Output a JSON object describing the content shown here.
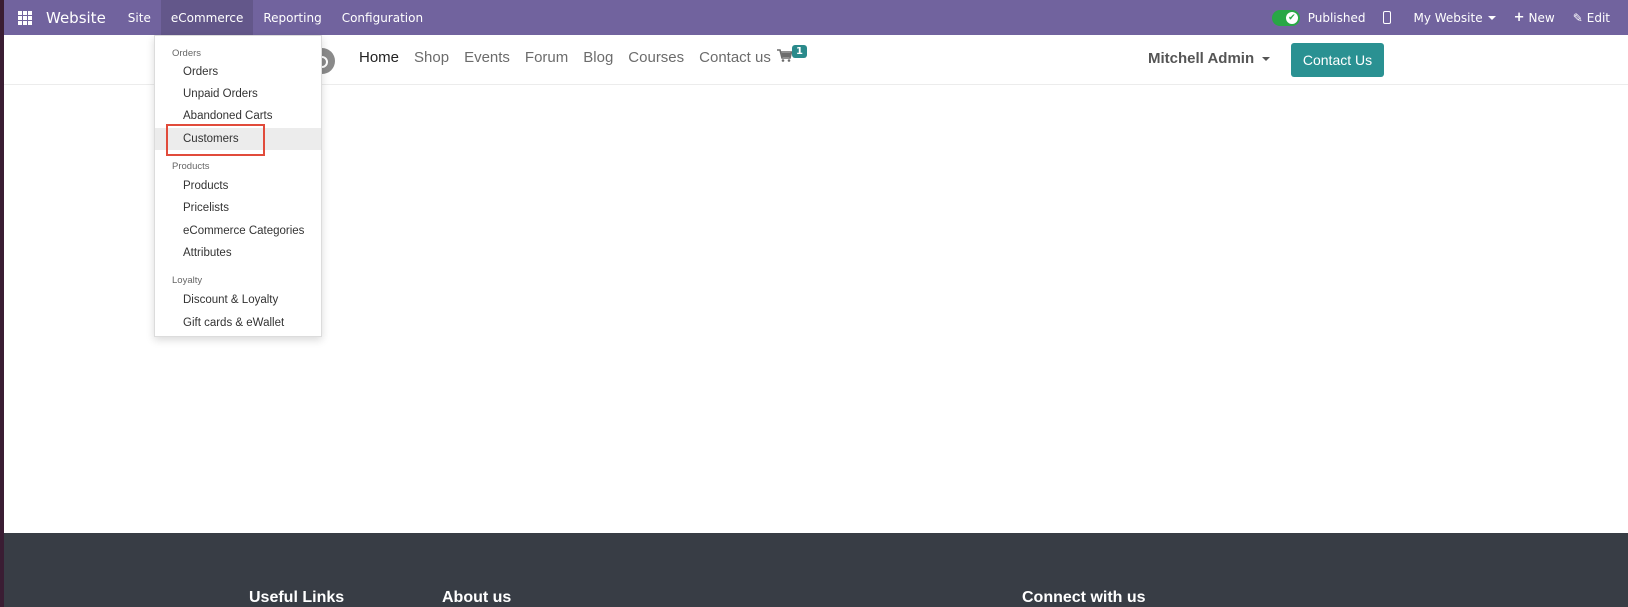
{
  "topbar": {
    "brand": "Website",
    "menu": [
      "Site",
      "eCommerce",
      "Reporting",
      "Configuration"
    ],
    "published_label": "Published",
    "website_label": "My Website",
    "new_label": "New",
    "edit_label": "Edit"
  },
  "site": {
    "nav": [
      "Home",
      "Shop",
      "Events",
      "Forum",
      "Blog",
      "Courses",
      "Contact us"
    ],
    "cart_count": "1",
    "user": "Mitchell Admin",
    "contact_button": "Contact Us"
  },
  "dropdown": {
    "sections": [
      {
        "header": "Orders",
        "items": [
          "Orders",
          "Unpaid Orders",
          "Abandoned Carts",
          "Customers"
        ]
      },
      {
        "header": "Products",
        "items": [
          "Products",
          "Pricelists",
          "eCommerce Categories",
          "Attributes"
        ]
      },
      {
        "header": "Loyalty",
        "items": [
          "Discount & Loyalty",
          "Gift cards & eWallet"
        ]
      }
    ],
    "highlighted_item": "Customers"
  },
  "footer": {
    "columns": [
      "Useful Links",
      "About us",
      "Connect with us"
    ]
  }
}
